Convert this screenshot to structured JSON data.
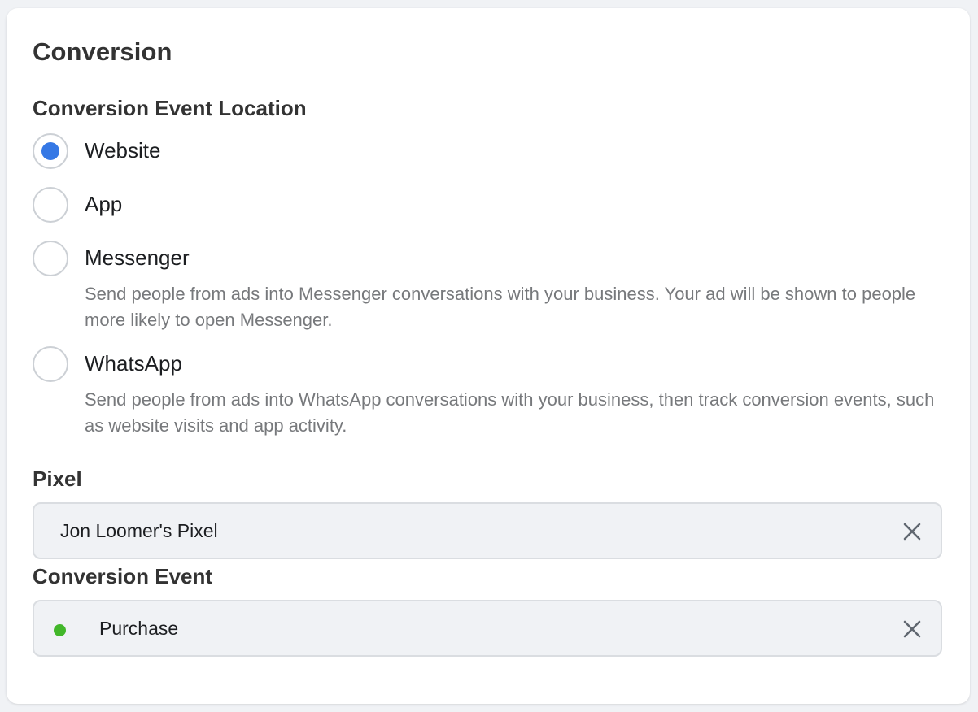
{
  "section_title": "Conversion",
  "location": {
    "label": "Conversion Event Location",
    "options": [
      {
        "label": "Website",
        "checked": true,
        "description": ""
      },
      {
        "label": "App",
        "checked": false,
        "description": ""
      },
      {
        "label": "Messenger",
        "checked": false,
        "description": "Send people from ads into Messenger conversations with your business. Your ad will be shown to people more likely to open Messenger."
      },
      {
        "label": "WhatsApp",
        "checked": false,
        "description": "Send people from ads into WhatsApp conversations with your business, then track conversion events, such as website visits and app activity."
      }
    ]
  },
  "pixel": {
    "label": "Pixel",
    "value": "Jon Loomer's Pixel",
    "clear_icon": "close-icon"
  },
  "conversion_event": {
    "label": "Conversion Event",
    "value": "Purchase",
    "status_icon": "status-dot-icon",
    "clear_icon": "close-icon"
  },
  "colors": {
    "radio_selected": "#3578e5",
    "status_active": "#42b72a",
    "field_background": "#f0f2f5",
    "description_text": "#77797c"
  }
}
